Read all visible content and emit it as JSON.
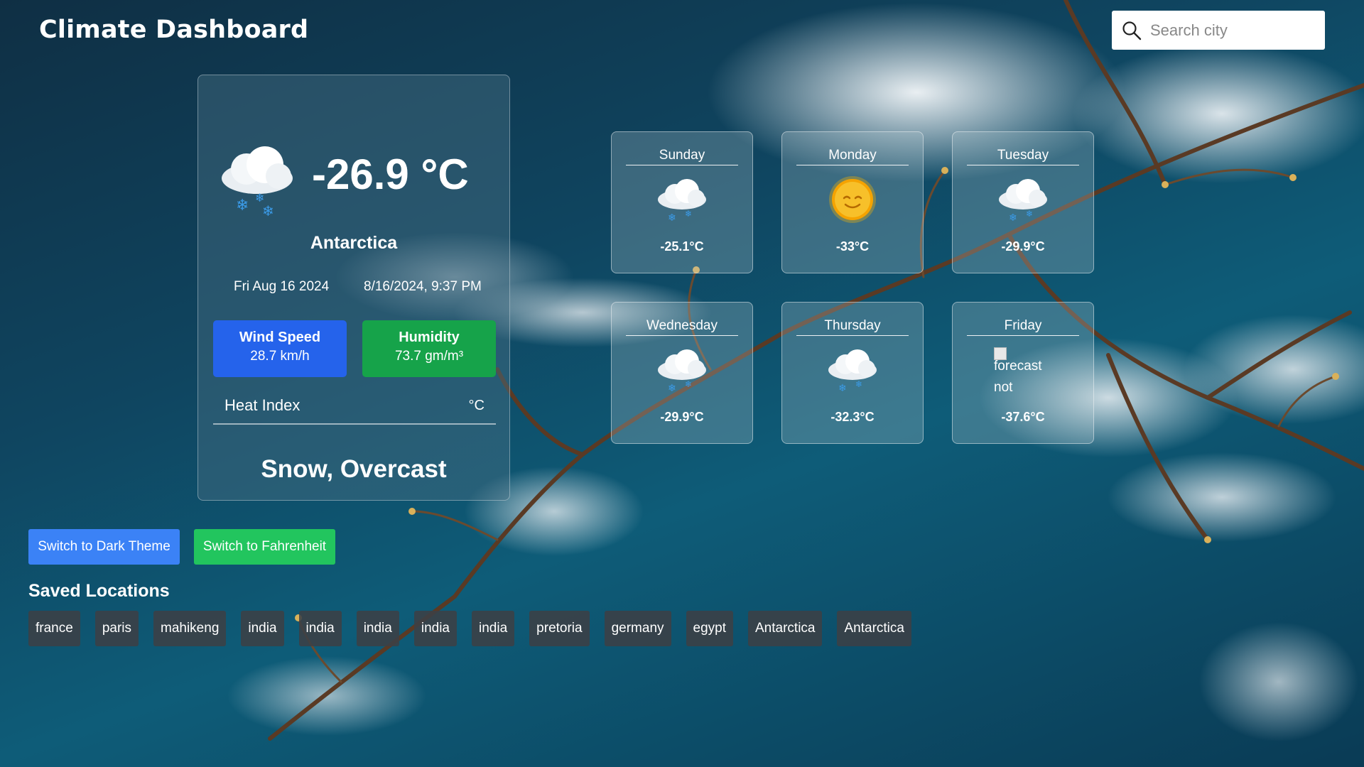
{
  "header": {
    "title": "Climate Dashboard"
  },
  "search": {
    "placeholder": "Search city",
    "icon": "search-icon"
  },
  "current": {
    "icon": "snow-cloud-icon",
    "temperature": "-26.9 °C",
    "city": "Antarctica",
    "date": "Fri Aug 16 2024",
    "datetime": "8/16/2024, 9:37 PM",
    "wind_label": "Wind Speed",
    "wind_value": "28.7 km/h",
    "humidity_label": "Humidity",
    "humidity_value": "73.7 gm/m³",
    "heat_index_label": "Heat Index",
    "heat_index_value": "°C",
    "condition": "Snow, Overcast"
  },
  "forecast": [
    {
      "day": "Sunday",
      "icon": "snow-cloud-icon",
      "temp": "-25.1°C"
    },
    {
      "day": "Monday",
      "icon": "sun-icon",
      "temp": "-33°C"
    },
    {
      "day": "Tuesday",
      "icon": "snow-cloud-icon",
      "temp": "-29.9°C"
    },
    {
      "day": "Wednesday",
      "icon": "snow-cloud-icon",
      "temp": "-29.9°C"
    },
    {
      "day": "Thursday",
      "icon": "snow-cloud-icon",
      "temp": "-32.3°C"
    },
    {
      "day": "Friday",
      "icon": "broken-image-icon",
      "alt_text_1": "forecast",
      "alt_text_2": "not",
      "temp": "-37.6°C"
    }
  ],
  "buttons": {
    "theme": "Switch to Dark Theme",
    "unit": "Switch to Fahrenheit"
  },
  "saved": {
    "title": "Saved Locations",
    "items": [
      "france",
      "paris",
      "mahikeng",
      "india",
      "india",
      "india",
      "india",
      "india",
      "pretoria",
      "germany",
      "egypt",
      "Antarctica",
      "Antarctica"
    ]
  },
  "colors": {
    "wind_bg": "#2563eb",
    "humidity_bg": "#16a34a",
    "theme_button": "#3b82f6",
    "unit_button": "#22c55e",
    "chip_bg": "#3c4046"
  }
}
